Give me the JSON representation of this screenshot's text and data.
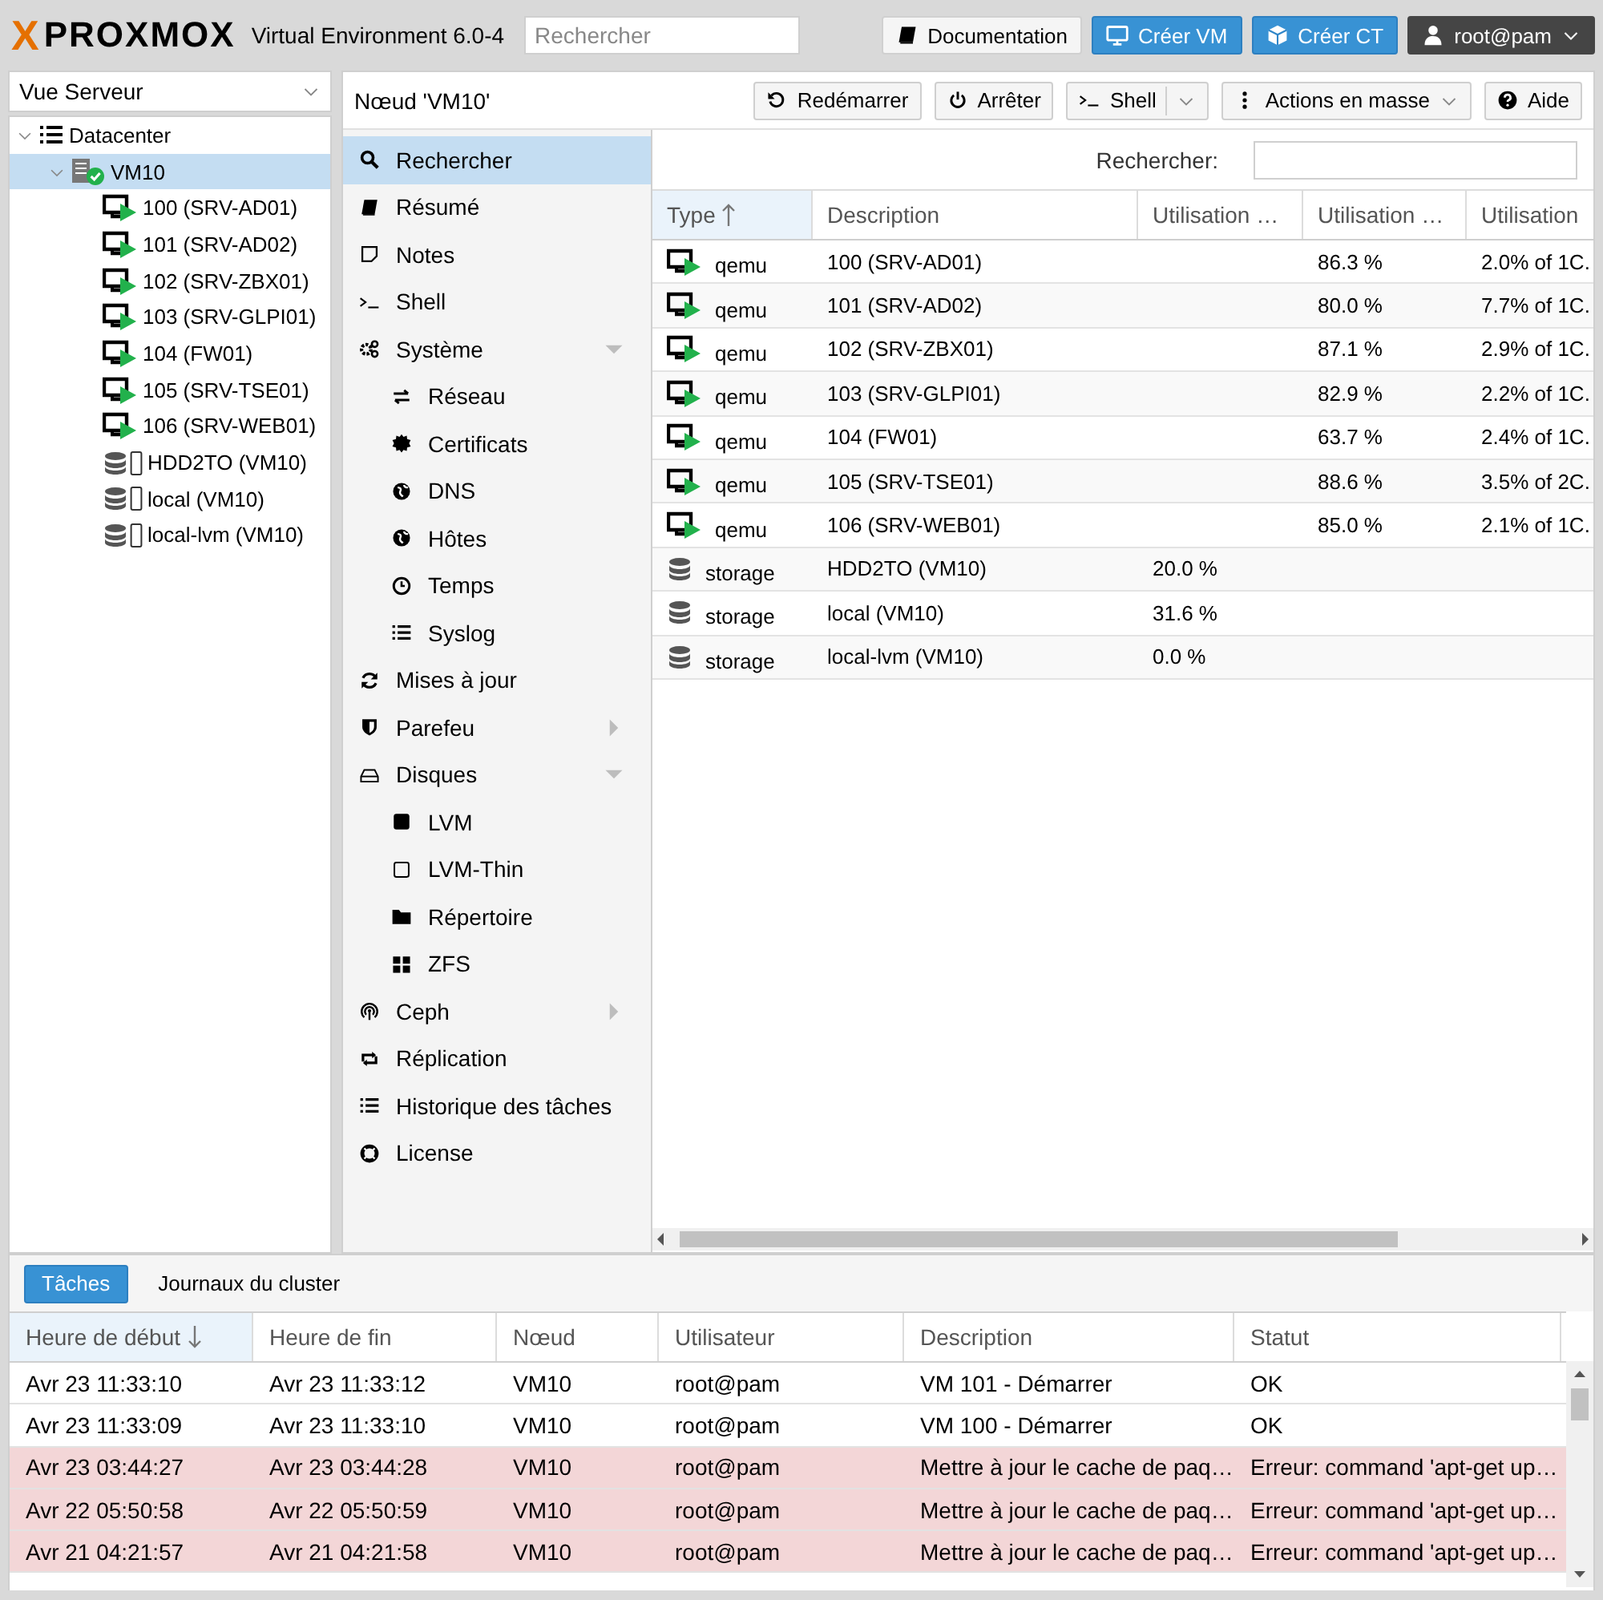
{
  "header": {
    "logo_x": "X",
    "logo": "PROXMOX",
    "version": "Virtual Environment 6.0-4",
    "search": {
      "placeholder": "Rechercher"
    },
    "buttons": [
      {
        "label": "Documentation",
        "kind": "plain"
      },
      {
        "label": "Créer VM",
        "kind": "primary"
      },
      {
        "label": "Créer CT",
        "kind": "primary"
      },
      {
        "label": "root@pam",
        "kind": "user"
      }
    ]
  },
  "view_selector": {
    "value": "Vue Serveur"
  },
  "tree": [
    {
      "label": "Datacenter",
      "kind": "datacenter",
      "expanded": true,
      "selected": false,
      "children": [
        {
          "label": "VM10",
          "kind": "node",
          "expanded": true,
          "selected": true,
          "online": true,
          "children": [
            {
              "label": "100 (SRV-AD01)",
              "kind": "vm",
              "running": true,
              "selected": false
            },
            {
              "label": "101 (SRV-AD02)",
              "kind": "vm",
              "running": true,
              "selected": false
            },
            {
              "label": "102 (SRV-ZBX01)",
              "kind": "vm",
              "running": true,
              "selected": false
            },
            {
              "label": "103 (SRV-GLPI01)",
              "kind": "vm",
              "running": true,
              "selected": false
            },
            {
              "label": "104 (FW01)",
              "kind": "vm",
              "running": true,
              "selected": false
            },
            {
              "label": "105 (SRV-TSE01)",
              "kind": "vm",
              "running": true,
              "selected": false
            },
            {
              "label": "106 (SRV-WEB01)",
              "kind": "vm",
              "running": true,
              "selected": false
            },
            {
              "label": "HDD2TO (VM10)",
              "kind": "storage",
              "selected": false
            },
            {
              "label": "local (VM10)",
              "kind": "storage",
              "selected": false
            },
            {
              "label": "local-lvm (VM10)",
              "kind": "storage",
              "selected": false
            }
          ]
        }
      ]
    }
  ],
  "panel": {
    "title": "Nœud 'VM10'",
    "toolbar": [
      {
        "label": "Redémarrer",
        "kind": "plain"
      },
      {
        "label": "Arrêter",
        "kind": "plain"
      },
      {
        "label": "Shell",
        "kind": "split"
      },
      {
        "label": "Actions en masse",
        "kind": "menu"
      },
      {
        "label": "Aide",
        "kind": "plain"
      }
    ],
    "menu": [
      {
        "label": "Rechercher",
        "selected": true
      },
      {
        "label": "Résumé",
        "selected": false
      },
      {
        "label": "Notes",
        "selected": false
      },
      {
        "label": "Shell",
        "selected": false
      },
      {
        "label": "Système",
        "selected": false,
        "expanded": true,
        "children": [
          {
            "label": "Réseau",
            "selected": false
          },
          {
            "label": "Certificats",
            "selected": false
          },
          {
            "label": "DNS",
            "selected": false
          },
          {
            "label": "Hôtes",
            "selected": false
          },
          {
            "label": "Temps",
            "selected": false
          },
          {
            "label": "Syslog",
            "selected": false
          }
        ]
      },
      {
        "label": "Mises à jour",
        "selected": false
      },
      {
        "label": "Parefeu",
        "selected": false,
        "expanded": false
      },
      {
        "label": "Disques",
        "selected": false,
        "expanded": true,
        "children": [
          {
            "label": "LVM",
            "selected": false
          },
          {
            "label": "LVM-Thin",
            "selected": false
          },
          {
            "label": "Répertoire",
            "selected": false
          },
          {
            "label": "ZFS",
            "selected": false
          }
        ]
      },
      {
        "label": "Ceph",
        "selected": false,
        "expanded": false
      },
      {
        "label": "Réplication",
        "selected": false
      },
      {
        "label": "Historique des tâches",
        "selected": false
      },
      {
        "label": "License",
        "selected": false
      }
    ],
    "search_label": "Rechercher:",
    "table": {
      "sort_descending": false,
      "columns": [
        {
          "label": "Type",
          "sorted": true
        },
        {
          "label": "Description",
          "sorted": false
        },
        {
          "label": "Utilisation …",
          "sorted": false
        },
        {
          "label": "Utilisation …",
          "sorted": false
        },
        {
          "label": "Utilisation",
          "sorted": false
        }
      ],
      "rows": [
        {
          "kind": "vm",
          "type": "qemu",
          "description": "100 (SRV-AD01)",
          "column_4": "86.3 %",
          "column_5": "2.0% of 1C."
        },
        {
          "kind": "vm",
          "type": "qemu",
          "description": "101 (SRV-AD02)",
          "column_4": "80.0 %",
          "column_5": "7.7% of 1C."
        },
        {
          "kind": "vm",
          "type": "qemu",
          "description": "102 (SRV-ZBX01)",
          "column_4": "87.1 %",
          "column_5": "2.9% of 1C."
        },
        {
          "kind": "vm",
          "type": "qemu",
          "description": "103 (SRV-GLPI01)",
          "column_4": "82.9 %",
          "column_5": "2.2% of 1C."
        },
        {
          "kind": "vm",
          "type": "qemu",
          "description": "104 (FW01)",
          "column_4": "63.7 %",
          "column_5": "2.4% of 1C."
        },
        {
          "kind": "vm",
          "type": "qemu",
          "description": "105 (SRV-TSE01)",
          "column_4": "88.6 %",
          "column_5": "3.5% of 2C."
        },
        {
          "kind": "vm",
          "type": "qemu",
          "description": "106 (SRV-WEB01)",
          "column_4": "85.0 %",
          "column_5": "2.1% of 1C."
        },
        {
          "kind": "storage",
          "type": "storage",
          "description": "HDD2TO (VM10)",
          "column_3": "20.0 %"
        },
        {
          "kind": "storage",
          "type": "storage",
          "description": "local (VM10)",
          "column_3": "31.6 %"
        },
        {
          "kind": "storage",
          "type": "storage",
          "description": "local-lvm (VM10)",
          "column_3": "0.0 %"
        }
      ]
    }
  },
  "tasks": {
    "tabs": [
      {
        "label": "Tâches",
        "selected": true
      },
      {
        "label": "Journaux du cluster",
        "selected": false
      }
    ],
    "sort_descending": true,
    "columns": [
      {
        "label": "Heure de début",
        "sorted": true
      },
      {
        "label": "Heure de fin",
        "sorted": false
      },
      {
        "label": "Nœud",
        "sorted": false
      },
      {
        "label": "Utilisateur",
        "sorted": false
      },
      {
        "label": "Description",
        "sorted": false
      },
      {
        "label": "Statut",
        "sorted": false
      }
    ],
    "rows": [
      {
        "failed": false,
        "cells": [
          "Avr 23 11:33:10",
          "Avr 23 11:33:12",
          "VM10",
          "root@pam",
          "VM 101 - Démarrer",
          "OK"
        ]
      },
      {
        "failed": false,
        "cells": [
          "Avr 23 11:33:09",
          "Avr 23 11:33:10",
          "VM10",
          "root@pam",
          "VM 100 - Démarrer",
          "OK"
        ]
      },
      {
        "failed": true,
        "cells": [
          "Avr 23 03:44:27",
          "Avr 23 03:44:28",
          "VM10",
          "root@pam",
          "Mettre à jour le cache de paq…",
          "Erreur: command 'apt-get up…"
        ]
      },
      {
        "failed": true,
        "cells": [
          "Avr 22 05:50:58",
          "Avr 22 05:50:59",
          "VM10",
          "root@pam",
          "Mettre à jour le cache de paq…",
          "Erreur: command 'apt-get up…"
        ]
      },
      {
        "failed": true,
        "cells": [
          "Avr 21 04:21:57",
          "Avr 21 04:21:58",
          "VM10",
          "root@pam",
          "Mettre à jour le cache de paq…",
          "Erreur: command 'apt-get up…"
        ]
      }
    ]
  }
}
